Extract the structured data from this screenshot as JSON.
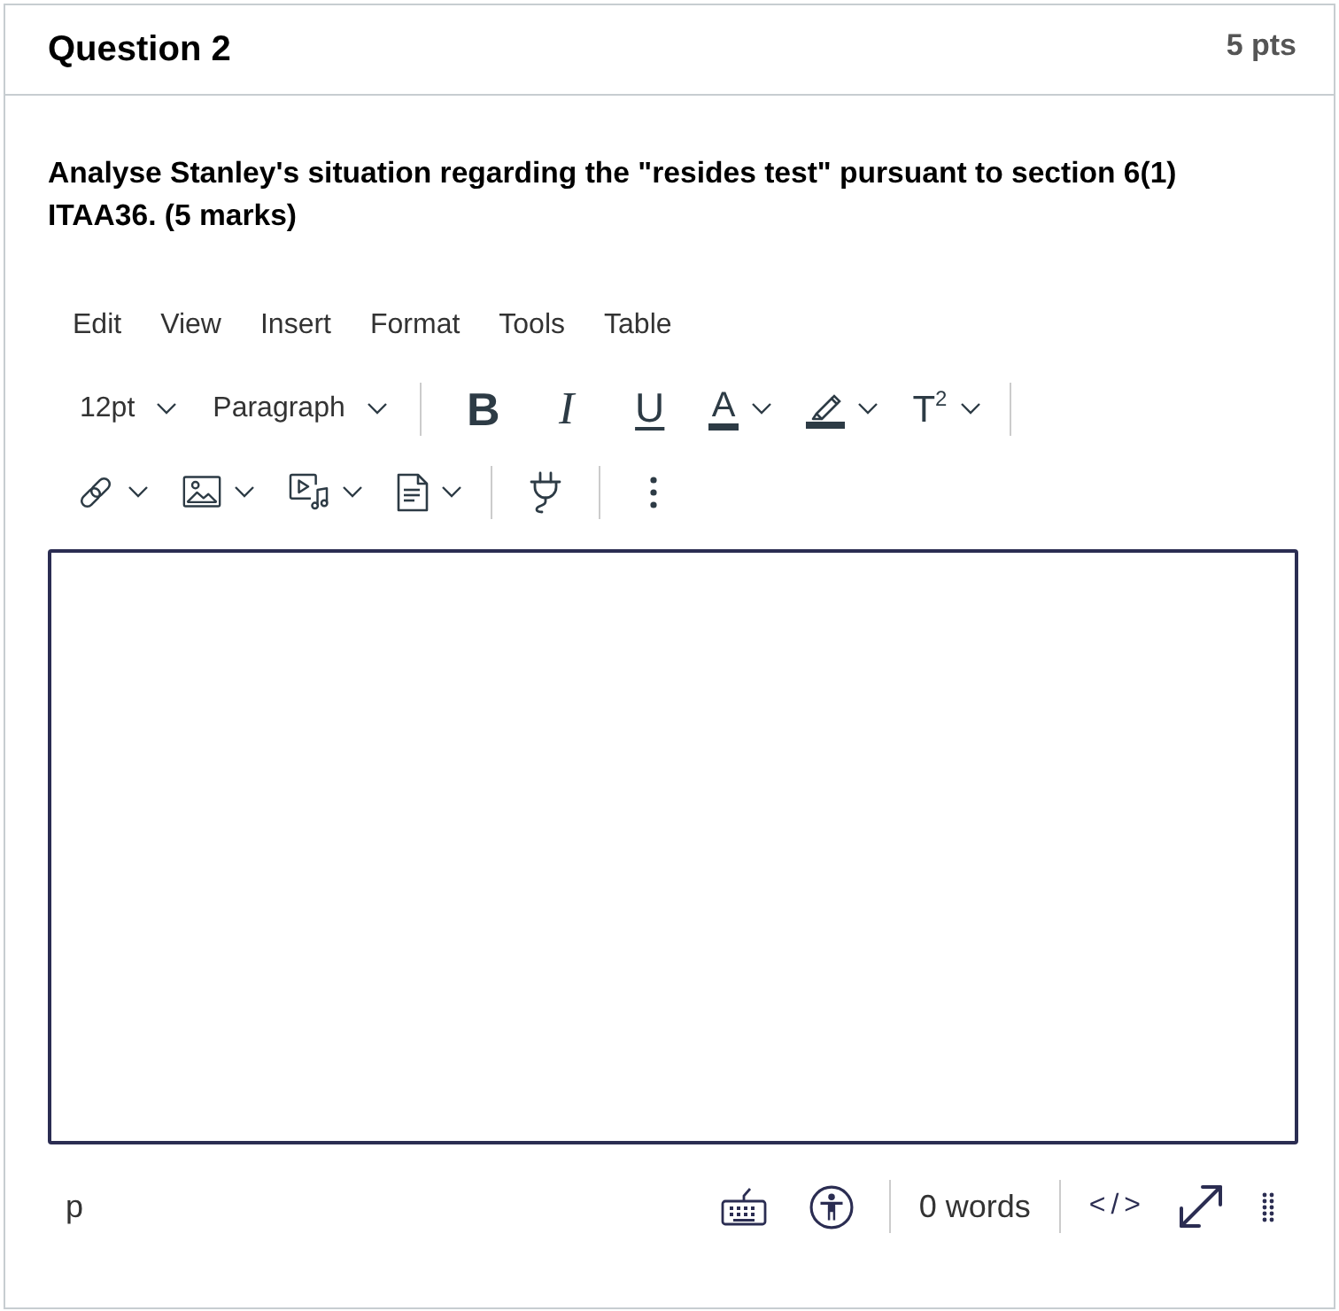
{
  "question": {
    "title": "Question 2",
    "points": "5 pts",
    "prompt": "Analyse Stanley's situation regarding the \"resides test\" pursuant to section 6(1) ITAA36. (5 marks)"
  },
  "editor": {
    "menu": [
      "Edit",
      "View",
      "Insert",
      "Format",
      "Tools",
      "Table"
    ],
    "toolbar": [
      {
        "groups": [
          {
            "items": [
              {
                "kind": "select",
                "label": "12pt",
                "menu": true
              },
              {
                "kind": "select",
                "label": "Paragraph",
                "menu": true
              }
            ]
          },
          {
            "items": [
              {
                "kind": "bold",
                "label": "B",
                "menu": false
              },
              {
                "kind": "italic",
                "label": "I",
                "menu": false
              },
              {
                "kind": "underline",
                "label": "U",
                "menu": false
              },
              {
                "kind": "text_color",
                "label": "A",
                "menu": true
              },
              {
                "kind": "highlight",
                "menu": true
              },
              {
                "kind": "superscript",
                "label": "T$^{2}$",
                "menu": true
              }
            ]
          }
        ]
      },
      {
        "groups": [
          {
            "items": [
              {
                "kind": "link",
                "menu": true
              },
              {
                "kind": "image",
                "menu": true
              },
              {
                "kind": "media",
                "menu": true
              },
              {
                "kind": "document",
                "menu": true
              }
            ]
          },
          {
            "items": [
              {
                "kind": "plugin",
                "menu": false
              }
            ]
          },
          {
            "items": [
              {
                "kind": "more",
                "menu": false
              }
            ]
          }
        ]
      }
    ],
    "focused": true,
    "status_bar": {
      "path": "p",
      "word_count": "0 words",
      "source_toggle": "</>"
    }
  }
}
